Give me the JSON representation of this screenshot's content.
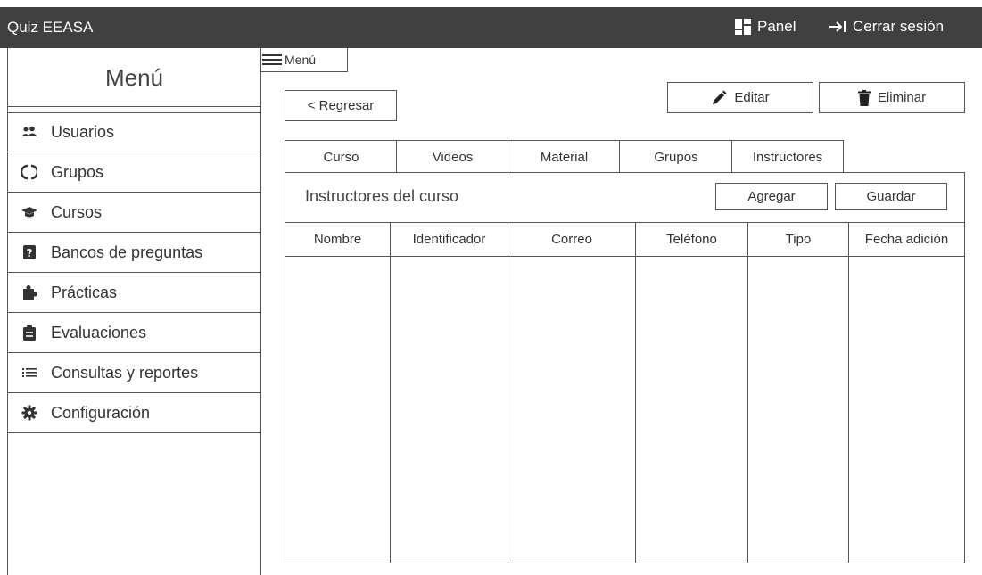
{
  "topbar": {
    "app_title": "Quiz EEASA",
    "panel_label": "Panel",
    "logout_label": "Cerrar sesión"
  },
  "sidebar": {
    "title": "Menú",
    "items": [
      {
        "label": "Usuarios",
        "icon": "users-icon"
      },
      {
        "label": "Grupos",
        "icon": "circle-notch-icon"
      },
      {
        "label": "Cursos",
        "icon": "graduation-cap-icon"
      },
      {
        "label": "Bancos de preguntas",
        "icon": "question-square-icon"
      },
      {
        "label": "Prácticas",
        "icon": "puzzle-icon"
      },
      {
        "label": "Evaluaciones",
        "icon": "clipboard-icon"
      },
      {
        "label": "Consultas y reportes",
        "icon": "list-icon"
      },
      {
        "label": "Configuración",
        "icon": "gear-icon"
      }
    ]
  },
  "menu_toggle": {
    "label": "Menú"
  },
  "actions": {
    "back_label": "< Regresar",
    "edit_label": "Editar",
    "delete_label": "Eliminar"
  },
  "tabs": [
    "Curso",
    "Videos",
    "Material",
    "Grupos",
    "Instructores"
  ],
  "section": {
    "title": "Instructores del curso",
    "add_label": "Agregar",
    "save_label": "Guardar"
  },
  "table": {
    "columns": [
      "Nombre",
      "Identificador",
      "Correo",
      "Teléfono",
      "Tipo",
      "Fecha adición"
    ],
    "rows": []
  }
}
